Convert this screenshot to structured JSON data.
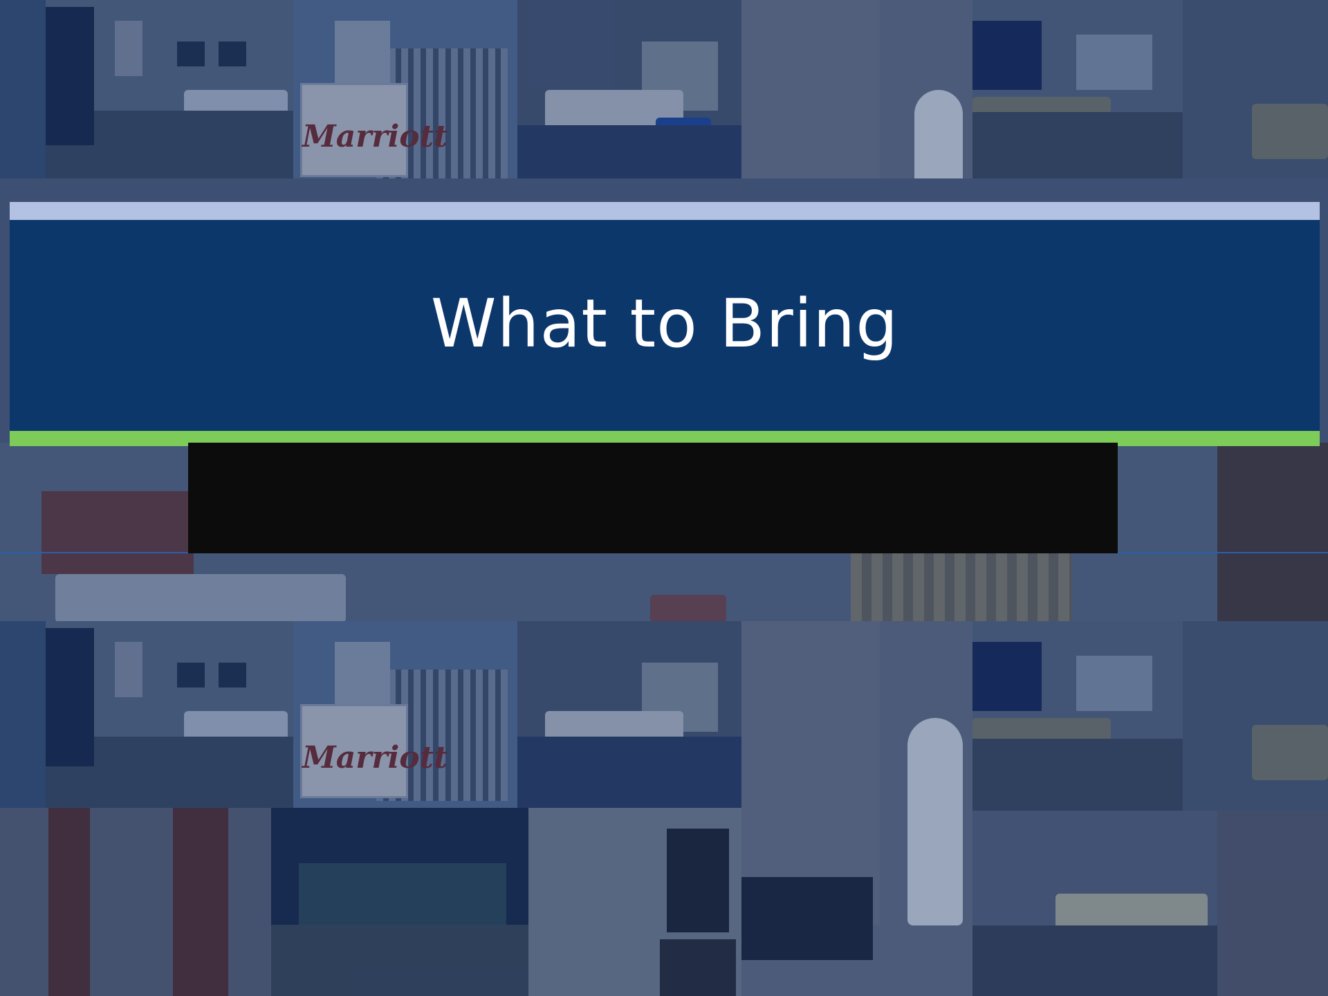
{
  "slide": {
    "title": "What to Bring"
  },
  "background": {
    "description_tiles": [
      {
        "kind": "hotel-room",
        "icon": "bed-icon"
      },
      {
        "kind": "hotel-exterior",
        "icon": "building-icon",
        "sign_text": "Marriott"
      },
      {
        "kind": "hotel-room",
        "icon": "bed-icon"
      },
      {
        "kind": "bathroom",
        "icon": "robe-icon"
      },
      {
        "kind": "hotel-room",
        "icon": "bed-icon"
      },
      {
        "kind": "hotel-room",
        "icon": "bed-icon"
      }
    ]
  },
  "colors": {
    "title_band": "#0c376b",
    "top_stripe": "#b3c1e3",
    "bottom_stripe": "#7dcc5a",
    "overlay_box": "#0c0c0c"
  }
}
